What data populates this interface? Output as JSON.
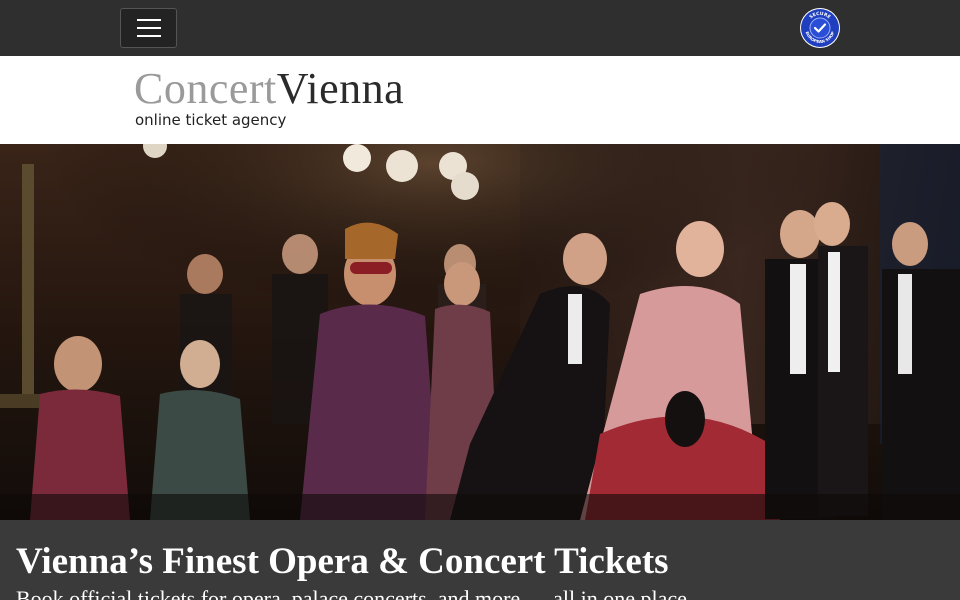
{
  "header": {
    "menu_icon": "hamburger-menu-icon",
    "badge": {
      "icon": "secure-shop-badge-icon",
      "text_top": "SECURE",
      "text_bottom": "EUROPEAN SHOP",
      "color": "#1f3fbf"
    }
  },
  "brand": {
    "logo_part1": "Concert",
    "logo_part2": "Vienna",
    "tagline": "online ticket agency"
  },
  "hero": {
    "image": "opera-stage-performance-photo"
  },
  "caption": {
    "title": "Vienna’s Finest Opera & Concert Tickets",
    "subtitle": "Book official tickets for opera, palace concerts, and more — all in one place."
  }
}
